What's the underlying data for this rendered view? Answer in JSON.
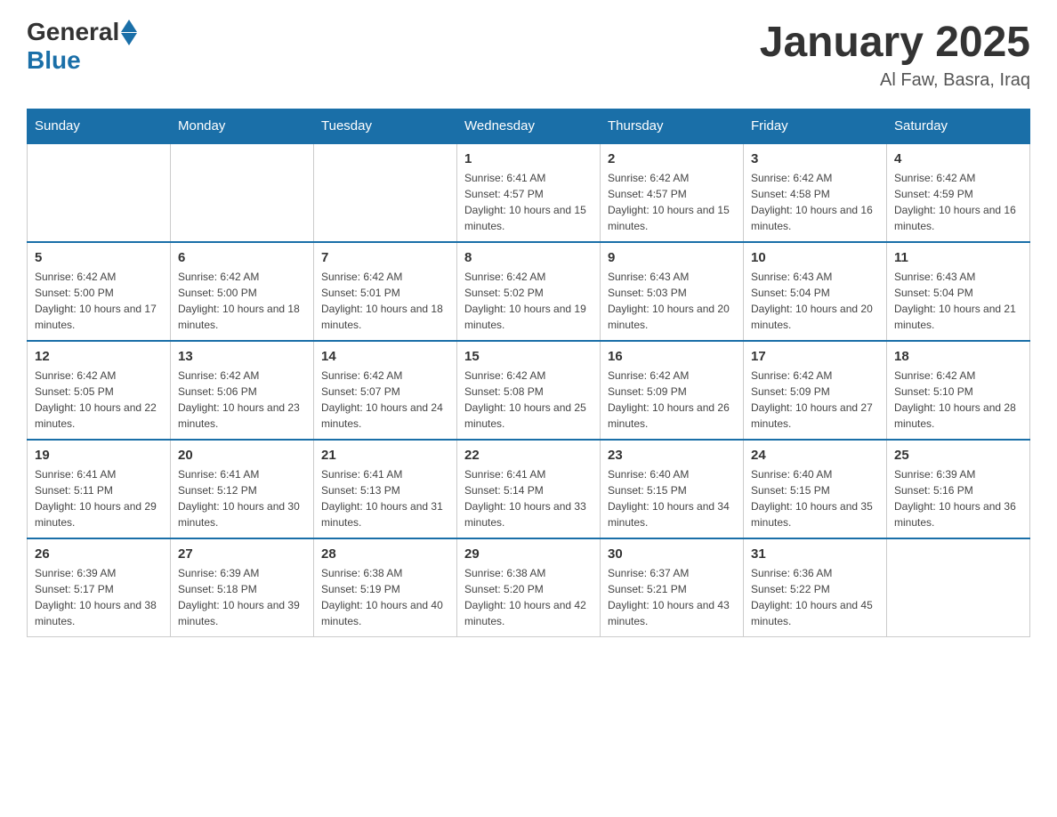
{
  "header": {
    "logo_general": "General",
    "logo_blue": "Blue",
    "title": "January 2025",
    "subtitle": "Al Faw, Basra, Iraq"
  },
  "calendar": {
    "days_of_week": [
      "Sunday",
      "Monday",
      "Tuesday",
      "Wednesday",
      "Thursday",
      "Friday",
      "Saturday"
    ],
    "weeks": [
      [
        {
          "day": "",
          "info": ""
        },
        {
          "day": "",
          "info": ""
        },
        {
          "day": "",
          "info": ""
        },
        {
          "day": "1",
          "info": "Sunrise: 6:41 AM\nSunset: 4:57 PM\nDaylight: 10 hours and 15 minutes."
        },
        {
          "day": "2",
          "info": "Sunrise: 6:42 AM\nSunset: 4:57 PM\nDaylight: 10 hours and 15 minutes."
        },
        {
          "day": "3",
          "info": "Sunrise: 6:42 AM\nSunset: 4:58 PM\nDaylight: 10 hours and 16 minutes."
        },
        {
          "day": "4",
          "info": "Sunrise: 6:42 AM\nSunset: 4:59 PM\nDaylight: 10 hours and 16 minutes."
        }
      ],
      [
        {
          "day": "5",
          "info": "Sunrise: 6:42 AM\nSunset: 5:00 PM\nDaylight: 10 hours and 17 minutes."
        },
        {
          "day": "6",
          "info": "Sunrise: 6:42 AM\nSunset: 5:00 PM\nDaylight: 10 hours and 18 minutes."
        },
        {
          "day": "7",
          "info": "Sunrise: 6:42 AM\nSunset: 5:01 PM\nDaylight: 10 hours and 18 minutes."
        },
        {
          "day": "8",
          "info": "Sunrise: 6:42 AM\nSunset: 5:02 PM\nDaylight: 10 hours and 19 minutes."
        },
        {
          "day": "9",
          "info": "Sunrise: 6:43 AM\nSunset: 5:03 PM\nDaylight: 10 hours and 20 minutes."
        },
        {
          "day": "10",
          "info": "Sunrise: 6:43 AM\nSunset: 5:04 PM\nDaylight: 10 hours and 20 minutes."
        },
        {
          "day": "11",
          "info": "Sunrise: 6:43 AM\nSunset: 5:04 PM\nDaylight: 10 hours and 21 minutes."
        }
      ],
      [
        {
          "day": "12",
          "info": "Sunrise: 6:42 AM\nSunset: 5:05 PM\nDaylight: 10 hours and 22 minutes."
        },
        {
          "day": "13",
          "info": "Sunrise: 6:42 AM\nSunset: 5:06 PM\nDaylight: 10 hours and 23 minutes."
        },
        {
          "day": "14",
          "info": "Sunrise: 6:42 AM\nSunset: 5:07 PM\nDaylight: 10 hours and 24 minutes."
        },
        {
          "day": "15",
          "info": "Sunrise: 6:42 AM\nSunset: 5:08 PM\nDaylight: 10 hours and 25 minutes."
        },
        {
          "day": "16",
          "info": "Sunrise: 6:42 AM\nSunset: 5:09 PM\nDaylight: 10 hours and 26 minutes."
        },
        {
          "day": "17",
          "info": "Sunrise: 6:42 AM\nSunset: 5:09 PM\nDaylight: 10 hours and 27 minutes."
        },
        {
          "day": "18",
          "info": "Sunrise: 6:42 AM\nSunset: 5:10 PM\nDaylight: 10 hours and 28 minutes."
        }
      ],
      [
        {
          "day": "19",
          "info": "Sunrise: 6:41 AM\nSunset: 5:11 PM\nDaylight: 10 hours and 29 minutes."
        },
        {
          "day": "20",
          "info": "Sunrise: 6:41 AM\nSunset: 5:12 PM\nDaylight: 10 hours and 30 minutes."
        },
        {
          "day": "21",
          "info": "Sunrise: 6:41 AM\nSunset: 5:13 PM\nDaylight: 10 hours and 31 minutes."
        },
        {
          "day": "22",
          "info": "Sunrise: 6:41 AM\nSunset: 5:14 PM\nDaylight: 10 hours and 33 minutes."
        },
        {
          "day": "23",
          "info": "Sunrise: 6:40 AM\nSunset: 5:15 PM\nDaylight: 10 hours and 34 minutes."
        },
        {
          "day": "24",
          "info": "Sunrise: 6:40 AM\nSunset: 5:15 PM\nDaylight: 10 hours and 35 minutes."
        },
        {
          "day": "25",
          "info": "Sunrise: 6:39 AM\nSunset: 5:16 PM\nDaylight: 10 hours and 36 minutes."
        }
      ],
      [
        {
          "day": "26",
          "info": "Sunrise: 6:39 AM\nSunset: 5:17 PM\nDaylight: 10 hours and 38 minutes."
        },
        {
          "day": "27",
          "info": "Sunrise: 6:39 AM\nSunset: 5:18 PM\nDaylight: 10 hours and 39 minutes."
        },
        {
          "day": "28",
          "info": "Sunrise: 6:38 AM\nSunset: 5:19 PM\nDaylight: 10 hours and 40 minutes."
        },
        {
          "day": "29",
          "info": "Sunrise: 6:38 AM\nSunset: 5:20 PM\nDaylight: 10 hours and 42 minutes."
        },
        {
          "day": "30",
          "info": "Sunrise: 6:37 AM\nSunset: 5:21 PM\nDaylight: 10 hours and 43 minutes."
        },
        {
          "day": "31",
          "info": "Sunrise: 6:36 AM\nSunset: 5:22 PM\nDaylight: 10 hours and 45 minutes."
        },
        {
          "day": "",
          "info": ""
        }
      ]
    ]
  }
}
